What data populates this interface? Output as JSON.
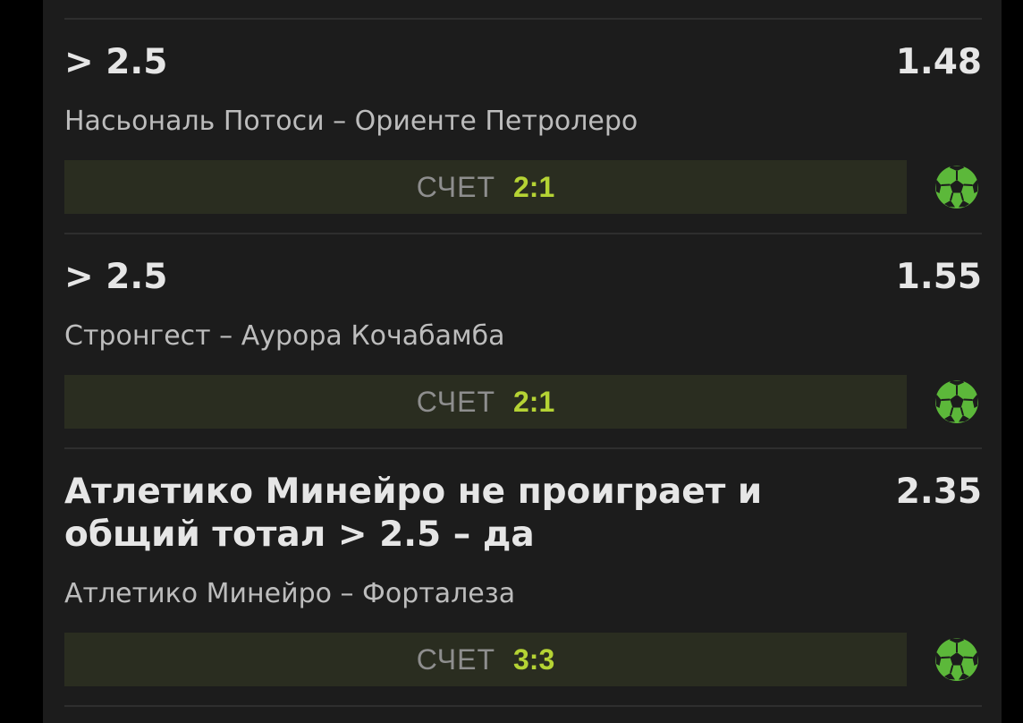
{
  "colors": {
    "background": "#000000",
    "panel": "#1c1c1c",
    "divider": "#2e2e2e",
    "score_bar": "#2a2d20",
    "score_value": "#b5d334",
    "ball_icon": "#5cb83a"
  },
  "bets": [
    {
      "title": "> 2.5",
      "odds": "1.48",
      "match": "Насьональ Потоси – Ориенте Петролеро",
      "score_label": "СЧЕТ",
      "score": "2:1",
      "icon": "soccer-ball-icon"
    },
    {
      "title": "> 2.5",
      "odds": "1.55",
      "match": "Стронгест – Аурора Кочабамба",
      "score_label": "СЧЕТ",
      "score": "2:1",
      "icon": "soccer-ball-icon"
    },
    {
      "title": "Атлетико Минейро не проиграет и общий тотал > 2.5 – да",
      "odds": "2.35",
      "match": "Атлетико Минейро – Форталеза",
      "score_label": "СЧЕТ",
      "score": "3:3",
      "icon": "soccer-ball-icon"
    }
  ]
}
